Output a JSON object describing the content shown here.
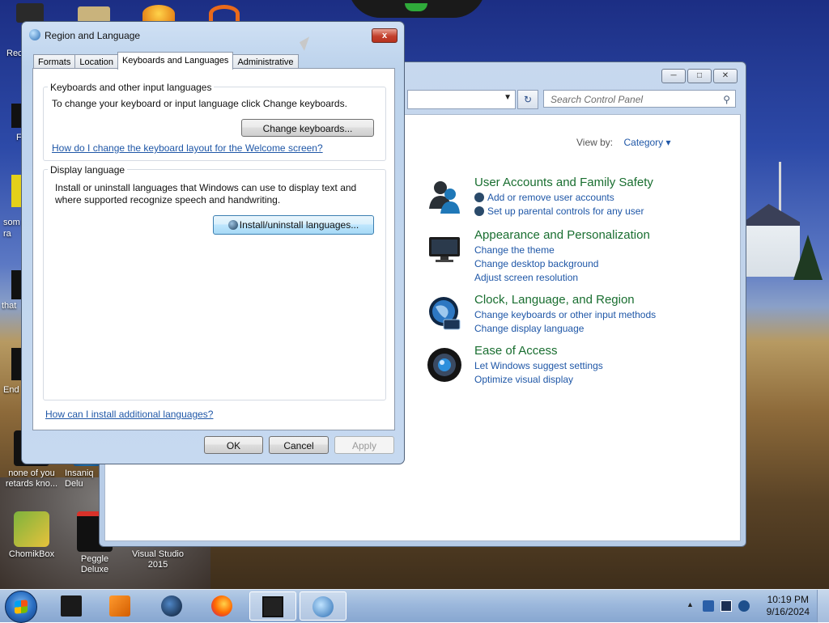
{
  "desktop": {
    "icons": [
      {
        "label": "ChomikBox"
      },
      {
        "label": "Peggle Deluxe"
      },
      {
        "label": "Visual Studio 2015"
      },
      {
        "label": "none of you retards kno..."
      },
      {
        "label": "Insaniq Delu"
      }
    ],
    "left_edge_labels": [
      "Rec",
      "F",
      "som ra",
      "that",
      "End"
    ]
  },
  "control_panel": {
    "search_placeholder": "Search Control Panel",
    "view_by_label": "View by:",
    "view_by_value": "Category",
    "categories": [
      {
        "title": "User Accounts and Family Safety",
        "icon": "user-accounts-icon",
        "links": [
          "Add or remove user accounts",
          "Set up parental controls for any user"
        ]
      },
      {
        "title": "Appearance and Personalization",
        "icon": "monitor-icon",
        "links": [
          "Change the theme",
          "Change desktop background",
          "Adjust screen resolution"
        ]
      },
      {
        "title": "Clock, Language, and Region",
        "icon": "clock-globe-icon",
        "links": [
          "Change keyboards or other input methods",
          "Change display language"
        ]
      },
      {
        "title": "Ease of Access",
        "icon": "ease-of-access-icon",
        "links": [
          "Let Windows suggest settings",
          "Optimize visual display"
        ]
      }
    ]
  },
  "dialog": {
    "title": "Region and Language",
    "close_label": "x",
    "tabs": [
      {
        "label": "Formats"
      },
      {
        "label": "Location"
      },
      {
        "label": "Keyboards and Languages"
      },
      {
        "label": "Administrative"
      }
    ],
    "keyboards_group": {
      "label": "Keyboards and other input languages",
      "description": "To change your keyboard or input language click Change keyboards.",
      "button": "Change keyboards...",
      "help_link": "How do I change the keyboard layout for the Welcome screen?"
    },
    "display_group": {
      "label": "Display language",
      "description_1": "Install or uninstall languages that Windows can use to display text and",
      "description_2": "where supported recognize speech and handwriting.",
      "button": "Install/uninstall languages..."
    },
    "bottom_link": "How can I install additional languages?",
    "ok": "OK",
    "cancel": "Cancel",
    "apply": "Apply"
  },
  "taskbar": {
    "clock_time": "10:19 PM",
    "clock_date": "9/16/2024"
  }
}
